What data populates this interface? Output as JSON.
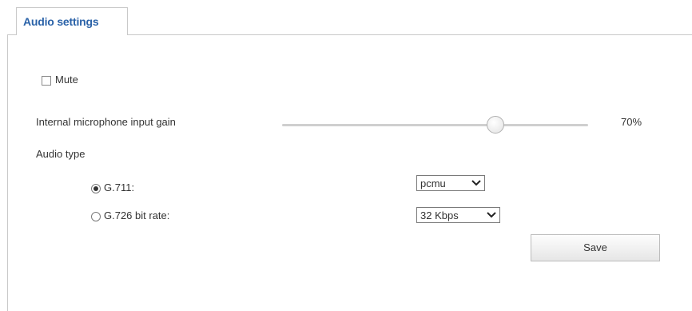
{
  "tab": {
    "label": "Audio settings"
  },
  "mute": {
    "label": "Mute",
    "checked": false
  },
  "gain": {
    "label": "Internal microphone input gain",
    "value_text": "70%",
    "value": 0.7
  },
  "audio_type": {
    "label": "Audio type",
    "options": [
      {
        "label": "G.711:",
        "selected": true
      },
      {
        "label": "G.726 bit rate:",
        "selected": false
      }
    ]
  },
  "g711_select": {
    "value": "pcmu"
  },
  "g726_select": {
    "value": "32 Kbps"
  },
  "save": {
    "label": "Save"
  }
}
